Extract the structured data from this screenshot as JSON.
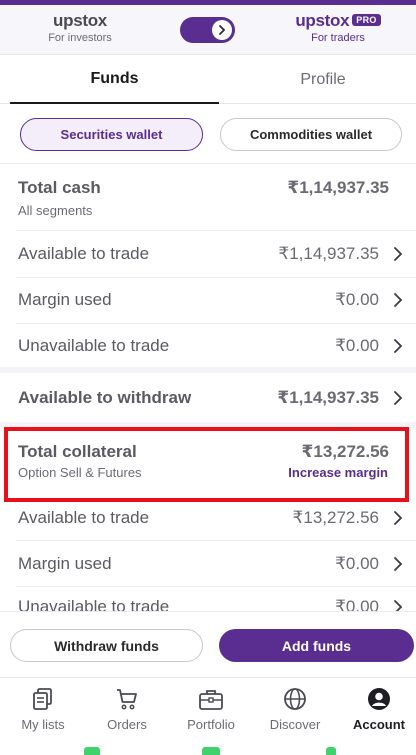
{
  "header": {
    "left_brand": {
      "logo": "upstox",
      "subtitle": "For investors"
    },
    "right_brand": {
      "logo": "upstox",
      "badge": "PRO",
      "subtitle": "For traders"
    },
    "toggle_icon": "chevron-right-icon"
  },
  "tabs": [
    {
      "label": "Funds",
      "active": true
    },
    {
      "label": "Profile",
      "active": false
    }
  ],
  "wallets": {
    "securities": "Securities wallet",
    "commodities": "Commodities wallet",
    "selected": "Securities wallet"
  },
  "total_cash": {
    "title": "Total cash",
    "subtitle": "All segments",
    "value": "₹1,14,937.35",
    "rows": [
      {
        "label": "Available to trade",
        "value": "₹1,14,937.35"
      },
      {
        "label": "Margin used",
        "value": "₹0.00"
      },
      {
        "label": "Unavailable to trade",
        "value": "₹0.00"
      }
    ]
  },
  "withdraw": {
    "label": "Available to withdraw",
    "value": "₹1,14,937.35"
  },
  "collateral": {
    "title": "Total collateral",
    "subtitle": "Option Sell & Futures",
    "value": "₹13,272.56",
    "link": "Increase margin",
    "rows": [
      {
        "label": "Available to trade",
        "value": "₹13,272.56"
      },
      {
        "label": "Margin used",
        "value": "₹0.00"
      },
      {
        "label": "Unavailable to trade",
        "value": "₹0.00"
      }
    ]
  },
  "actions": {
    "withdraw": "Withdraw funds",
    "add": "Add funds"
  },
  "bottom_nav": [
    {
      "label": "My lists",
      "icon": "lists-icon"
    },
    {
      "label": "Orders",
      "icon": "cart-icon"
    },
    {
      "label": "Portfolio",
      "icon": "briefcase-icon"
    },
    {
      "label": "Discover",
      "icon": "globe-icon"
    },
    {
      "label": "Account",
      "icon": "account-icon",
      "active": true
    }
  ],
  "colors": {
    "brand": "#5a2d91",
    "highlight": "#e8101a",
    "accent_green": "#3fd16a"
  }
}
